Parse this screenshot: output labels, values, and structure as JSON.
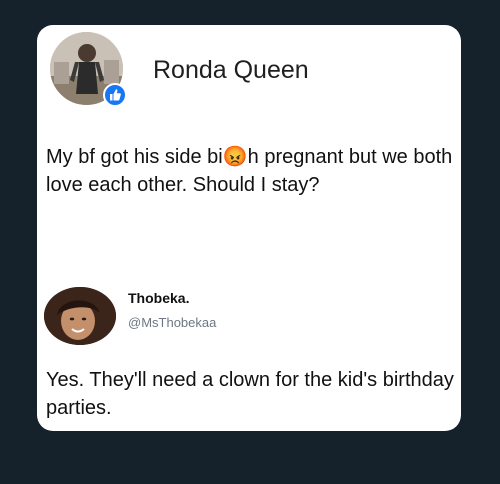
{
  "post": {
    "author_name": "Ronda Queen",
    "text": "My bf got his side bi😡h pregnant but we both love each other. Should I stay?"
  },
  "reply": {
    "author_name": "Thobeka.",
    "handle": "@MsThobekaa",
    "text": "Yes. They'll need a clown for the kid's birthday parties."
  },
  "colors": {
    "background": "#15212b",
    "card": "#ffffff",
    "like_badge": "#1877f2",
    "handle_text": "#6d7884"
  },
  "icons": {
    "badge": "like-icon"
  }
}
